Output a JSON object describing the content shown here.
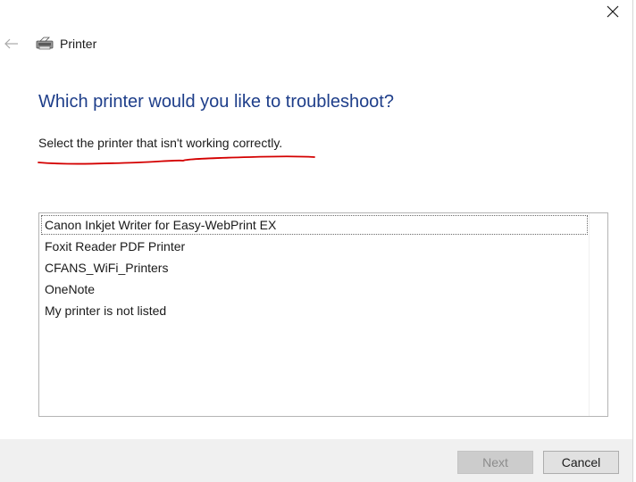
{
  "window": {
    "title": "Printer",
    "icons": {
      "close": "close-icon",
      "back": "back-arrow-icon",
      "title": "printer-icon"
    }
  },
  "page": {
    "heading": "Which printer would you like to troubleshoot?",
    "instruction": "Select the printer that isn't working correctly."
  },
  "printers": {
    "selected_index": 0,
    "items": [
      {
        "label": "Canon Inkjet Writer for Easy-WebPrint EX"
      },
      {
        "label": "Foxit Reader PDF Printer"
      },
      {
        "label": "CFANS_WiFi_Printers"
      },
      {
        "label": "OneNote"
      },
      {
        "label": "My printer is not listed"
      }
    ]
  },
  "footer": {
    "next_label": "Next",
    "cancel_label": "Cancel",
    "next_enabled": false
  },
  "colors": {
    "heading": "#1e3e8a",
    "annotation": "#d40000",
    "footer_bg": "#f0f0f0"
  }
}
